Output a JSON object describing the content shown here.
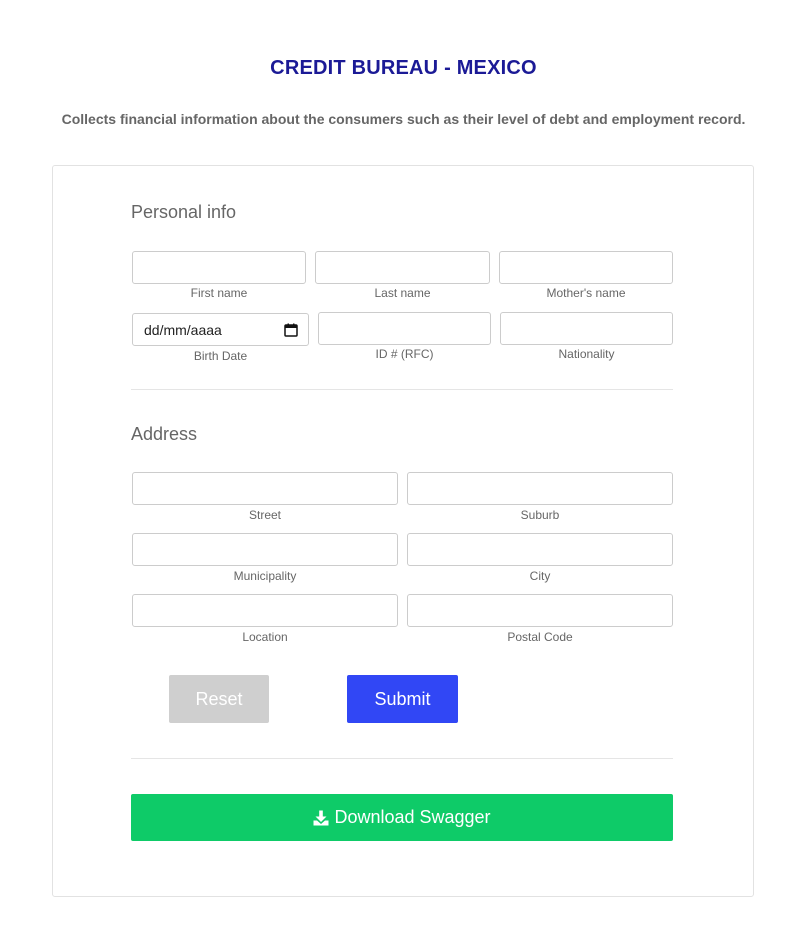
{
  "header": {
    "title": "CREDIT BUREAU - MEXICO",
    "subtitle": "Collects financial information about the consumers such as their level of debt and employment record."
  },
  "personal": {
    "section_title": "Personal info",
    "first_name_label": "First name",
    "last_name_label": "Last name",
    "mother_name_label": "Mother's name",
    "birth_date_placeholder": "dd/mm/aaaa",
    "birth_date_label": "Birth Date",
    "id_label": "ID # (RFC)",
    "nationality_label": "Nationality"
  },
  "address": {
    "section_title": "Address",
    "street_label": "Street",
    "suburb_label": "Suburb",
    "municipality_label": "Municipality",
    "city_label": "City",
    "location_label": "Location",
    "postal_code_label": "Postal Code"
  },
  "actions": {
    "reset_label": "Reset",
    "submit_label": "Submit",
    "download_label": "Download Swagger"
  },
  "colors": {
    "title": "#1b1a96",
    "submit": "#3147f5",
    "reset": "#cfcfcf",
    "download": "#0ecb68"
  },
  "icons": {
    "calendar": "calendar-icon",
    "download": "download-icon"
  }
}
